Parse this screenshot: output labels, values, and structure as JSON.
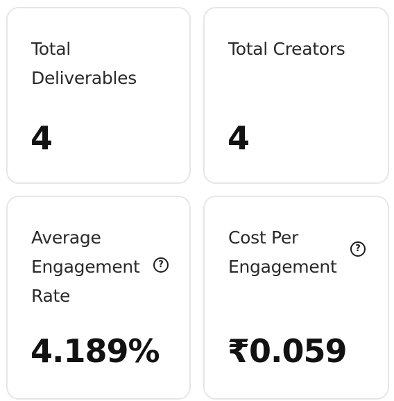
{
  "cards": [
    {
      "label": "Total Deliverables",
      "value": "4"
    },
    {
      "label": "Total Creators",
      "value": "4"
    },
    {
      "label": "Average Engagement Rate",
      "value": "4.189%",
      "help_icon": "question-circle-icon"
    },
    {
      "label": "Cost Per Engagement",
      "value": "₹0.059",
      "help_icon": "question-circle-icon"
    }
  ],
  "help_glyph": "?"
}
